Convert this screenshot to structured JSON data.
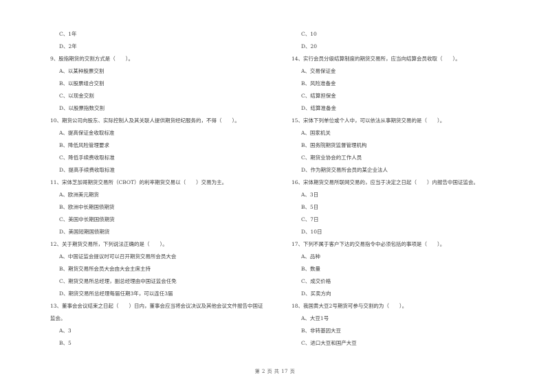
{
  "left_column": [
    {
      "type": "option",
      "text": "C、1年"
    },
    {
      "type": "option",
      "text": "D、2年"
    },
    {
      "type": "question",
      "text": "9、股指期货的交割方式是（　　）。"
    },
    {
      "type": "option",
      "text": "A、以某种股票交割"
    },
    {
      "type": "option",
      "text": "B、以股票组合交割"
    },
    {
      "type": "option",
      "text": "C、以现金交割"
    },
    {
      "type": "option",
      "text": "D、以股票指数交割"
    },
    {
      "type": "question",
      "text": "10、期货公司向股东、实际控制人及其关联人提供期货经纪服务的，不得（　　）。"
    },
    {
      "type": "option",
      "text": "A、提高保证金收取标准"
    },
    {
      "type": "option",
      "text": "B、降低风险管理要求"
    },
    {
      "type": "option",
      "text": "C、降低手续费收取标准"
    },
    {
      "type": "option",
      "text": "D、提高手续费收取标准"
    },
    {
      "type": "question",
      "text": "11、宋体芝加哥期货交易所（CBOT）的利率期货交易以（　　）交易为主。"
    },
    {
      "type": "option",
      "text": "A、欧洲美元期货"
    },
    {
      "type": "option",
      "text": "B、欧洲中长期国债期货"
    },
    {
      "type": "option",
      "text": "C、美国中长期国债期货"
    },
    {
      "type": "option",
      "text": "D、美国短期国债期货"
    },
    {
      "type": "question",
      "text": "12、关于期货交易所，下列说法正确的是（　　）。"
    },
    {
      "type": "option",
      "text": "A、中国证监会提议时可以召开期货交易所会员大会"
    },
    {
      "type": "option",
      "text": "B、期货交易所会员大会由大会主席主持"
    },
    {
      "type": "option",
      "text": "C、期货交易所总经理，副总经理由中国证监会任免"
    },
    {
      "type": "option",
      "text": "D、期货交易所总经理每届任期3年，可以连任3届"
    },
    {
      "type": "question",
      "text": "13、董事会会议结束之日起（　　）日内，董事会应当将会议决议及其他会议文件报告中国证"
    },
    {
      "type": "question-cont",
      "text": "监会。"
    },
    {
      "type": "option",
      "text": "A、3"
    },
    {
      "type": "option",
      "text": "B、5"
    }
  ],
  "right_column": [
    {
      "type": "option",
      "text": "C、10"
    },
    {
      "type": "option",
      "text": "D、20"
    },
    {
      "type": "question",
      "text": "14、实行会员分级结算制度的期货交易所，应当向结算会员收取（　　）。"
    },
    {
      "type": "option",
      "text": "A、交易保证金"
    },
    {
      "type": "option",
      "text": "B、风险准备金"
    },
    {
      "type": "option",
      "text": "C、结算担保金"
    },
    {
      "type": "option",
      "text": "D、结算准备金"
    },
    {
      "type": "question",
      "text": "15、宋体下列单位或个人中，可以依法从事期货交易的是（　　）。"
    },
    {
      "type": "option",
      "text": "A、国家机关"
    },
    {
      "type": "option",
      "text": "B、国务院期货监督管理机构"
    },
    {
      "type": "option",
      "text": "C、期货业协会的工作人员"
    },
    {
      "type": "option",
      "text": "D、作为期货交易所会员的某企业法人"
    },
    {
      "type": "question",
      "text": "16、宋体期货交易所联网交易的，应当于决定之日起（　　）内报告中国证监会。"
    },
    {
      "type": "option",
      "text": "A、3日"
    },
    {
      "type": "option",
      "text": "B、5日"
    },
    {
      "type": "option",
      "text": "C、7日"
    },
    {
      "type": "option",
      "text": "D、10日"
    },
    {
      "type": "question",
      "text": "17、下列不属于客户下达的交易指令中必须包括的事项是（　　）。"
    },
    {
      "type": "option",
      "text": "A、品种"
    },
    {
      "type": "option",
      "text": "B、数量"
    },
    {
      "type": "option",
      "text": "C、成交价格"
    },
    {
      "type": "option",
      "text": "D、买卖方向"
    },
    {
      "type": "question",
      "text": "18、我国黄大豆2号期货可参与交割的为（　　）。"
    },
    {
      "type": "option",
      "text": "A、大豆1号"
    },
    {
      "type": "option",
      "text": "B、非转基因大豆"
    },
    {
      "type": "option",
      "text": "C、进口大豆和国产大豆"
    }
  ],
  "footer": {
    "page_label": "第 2 页 共 17 页"
  }
}
